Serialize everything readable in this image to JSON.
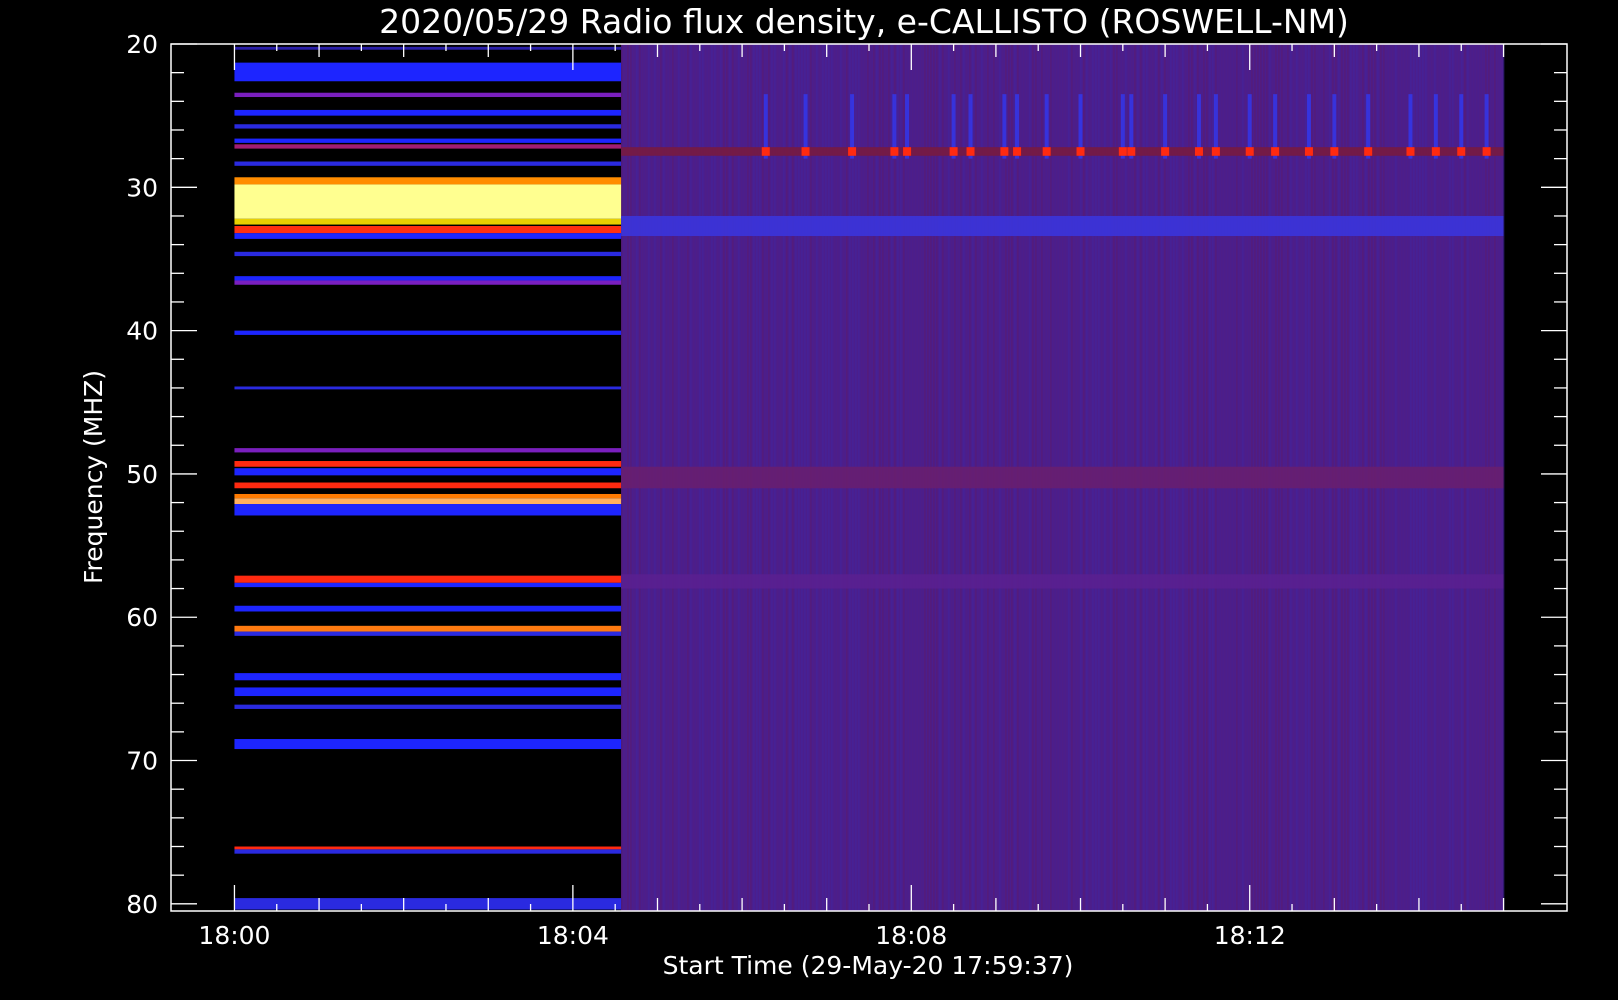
{
  "chart_data": {
    "type": "heatmap",
    "title": "2020/05/29  Radio flux density, e-CALLISTO (ROSWELL-NM)",
    "xlabel": "Start Time (29-May-20 17:59:37)",
    "ylabel": "Frequency (MHZ)",
    "x_range_minutes_after_1800": [
      -0.75,
      15.75
    ],
    "data_x_range_minutes_after_1800": [
      0,
      15
    ],
    "ylim": [
      80.5,
      20.0
    ],
    "y_inverted": true,
    "x_ticks": [
      {
        "minute": 0,
        "label": "18:00"
      },
      {
        "minute": 4,
        "label": "18:04"
      },
      {
        "minute": 8,
        "label": "18:08"
      },
      {
        "minute": 12,
        "label": "18:12"
      }
    ],
    "y_ticks": [
      20,
      30,
      40,
      50,
      60,
      70,
      80
    ],
    "segment_boundary_minute": 4.57,
    "segment1_background": "#000000",
    "segment2_background": "#4b1e8c",
    "segment1_bands": [
      {
        "f0": 20.2,
        "f1": 20.4,
        "color": "#2a1fa8"
      },
      {
        "f0": 21.3,
        "f1": 22.6,
        "color": "#1d25ff"
      },
      {
        "f0": 23.4,
        "f1": 23.7,
        "color": "#7a1fbe"
      },
      {
        "f0": 24.6,
        "f1": 25.0,
        "color": "#1d25ff"
      },
      {
        "f0": 25.6,
        "f1": 25.9,
        "color": "#2a2ae0"
      },
      {
        "f0": 26.6,
        "f1": 26.9,
        "color": "#1d25ff"
      },
      {
        "f0": 27.0,
        "f1": 27.3,
        "color": "#a01e72"
      },
      {
        "f0": 28.2,
        "f1": 28.5,
        "color": "#2a2ae0"
      },
      {
        "f0": 29.3,
        "f1": 29.8,
        "color": "#ff8c00"
      },
      {
        "f0": 29.8,
        "f1": 32.2,
        "color": "#ffff90"
      },
      {
        "f0": 32.2,
        "f1": 32.6,
        "color": "#e8d000"
      },
      {
        "f0": 32.7,
        "f1": 33.2,
        "color": "#ff3010"
      },
      {
        "f0": 33.2,
        "f1": 33.6,
        "color": "#1d25ff"
      },
      {
        "f0": 34.5,
        "f1": 34.8,
        "color": "#2a2ae0"
      },
      {
        "f0": 36.2,
        "f1": 36.5,
        "color": "#1d25ff"
      },
      {
        "f0": 36.5,
        "f1": 36.8,
        "color": "#7a1fbe"
      },
      {
        "f0": 40.0,
        "f1": 40.3,
        "color": "#1d25ff"
      },
      {
        "f0": 43.9,
        "f1": 44.1,
        "color": "#2a2ae0"
      },
      {
        "f0": 48.2,
        "f1": 48.5,
        "color": "#7a1fbe"
      },
      {
        "f0": 49.1,
        "f1": 49.5,
        "color": "#ff2a10"
      },
      {
        "f0": 49.6,
        "f1": 50.1,
        "color": "#1d25ff"
      },
      {
        "f0": 50.6,
        "f1": 51.0,
        "color": "#ff2a10"
      },
      {
        "f0": 51.4,
        "f1": 51.7,
        "color": "#ff7a00"
      },
      {
        "f0": 51.7,
        "f1": 52.1,
        "color": "#ffb060"
      },
      {
        "f0": 52.1,
        "f1": 52.9,
        "color": "#1d25ff"
      },
      {
        "f0": 57.1,
        "f1": 57.6,
        "color": "#ff2a10"
      },
      {
        "f0": 57.6,
        "f1": 57.9,
        "color": "#1d25ff"
      },
      {
        "f0": 59.2,
        "f1": 59.6,
        "color": "#1d25ff"
      },
      {
        "f0": 60.6,
        "f1": 61.0,
        "color": "#ff7a10"
      },
      {
        "f0": 61.0,
        "f1": 61.3,
        "color": "#2a2ae0"
      },
      {
        "f0": 63.9,
        "f1": 64.4,
        "color": "#1d25ff"
      },
      {
        "f0": 64.9,
        "f1": 65.5,
        "color": "#1d25ff"
      },
      {
        "f0": 66.1,
        "f1": 66.4,
        "color": "#2a2ae0"
      },
      {
        "f0": 68.5,
        "f1": 69.2,
        "color": "#1d25ff"
      },
      {
        "f0": 76.0,
        "f1": 76.2,
        "color": "#ff2a10"
      },
      {
        "f0": 76.2,
        "f1": 76.5,
        "color": "#2a2ae0"
      },
      {
        "f0": 79.6,
        "f1": 80.4,
        "color": "#2a2ae0"
      }
    ],
    "segment2_bands": [
      {
        "f0": 27.2,
        "f1": 27.8,
        "color": "#7a1a3c"
      },
      {
        "f0": 32.0,
        "f1": 33.4,
        "color": "#3a36e0"
      },
      {
        "f0": 49.5,
        "f1": 51.0,
        "color": "#6a1e6e"
      },
      {
        "f0": 57.0,
        "f1": 58.0,
        "color": "#5a2090"
      }
    ],
    "burst_minutes": [
      6.28,
      6.75,
      7.3,
      7.8,
      7.95,
      8.5,
      8.7,
      9.1,
      9.25,
      9.6,
      10.0,
      10.5,
      10.6,
      11.0,
      11.4,
      11.6,
      12.0,
      12.3,
      12.7,
      13.0,
      13.4,
      13.9,
      14.2,
      14.5,
      14.8
    ],
    "burst_freq_range": [
      23.5,
      28.0
    ],
    "burst_color": "#ff2a10",
    "burst_stripe_color": "#2d3cff"
  }
}
